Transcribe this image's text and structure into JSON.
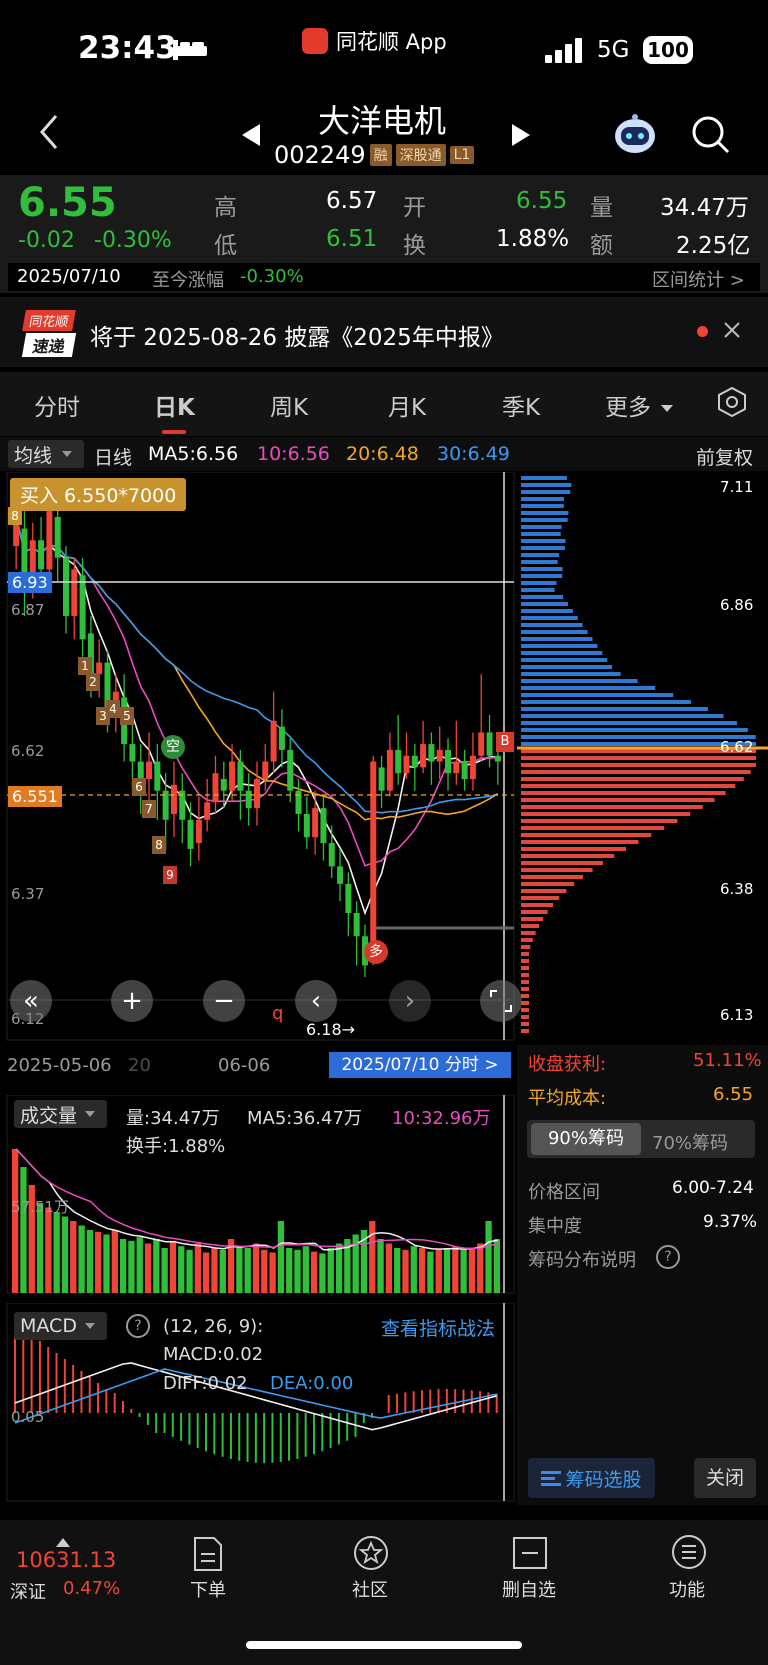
{
  "status": {
    "time": "23:43",
    "app": "同花顺 App",
    "net": "5G",
    "battery": "100"
  },
  "header": {
    "name": "大洋电机",
    "code": "002249",
    "tags": [
      "融",
      "深股通",
      "L1"
    ]
  },
  "quote": {
    "price": "6.55",
    "change": "-0.02",
    "pct": "-0.30%",
    "high_label": "高",
    "high": "6.57",
    "low_label": "低",
    "low": "6.51",
    "open_label": "开",
    "open": "6.55",
    "turn_label": "换",
    "turn": "1.88%",
    "vol_label": "量",
    "vol": "34.47万",
    "amt_label": "额",
    "amt": "2.25亿",
    "date": "2025/07/10",
    "since_label": "至今涨幅",
    "since": "-0.30%",
    "stat": "区间统计 >"
  },
  "notice": {
    "logo_top": "同花顺",
    "logo_bottom": "速递",
    "text": "将于 2025-08-26 披露《2025年中报》"
  },
  "tabs": [
    "分时",
    "日K",
    "周K",
    "月K",
    "季K",
    "更多"
  ],
  "ma_bar": {
    "select": "均线",
    "period": "日线",
    "ma5": "MA5:6.56",
    "ma10": "10:6.56",
    "ma20": "20:6.48",
    "ma30": "30:6.49",
    "adj": "前复权"
  },
  "chart": {
    "buy_label": "买入 6.550*7000",
    "price_marks": {
      "p693": "6.93",
      "p687": "6.87",
      "p662": "6.62",
      "p6551": "6.551",
      "p637": "6.37",
      "p612": "6.12",
      "low_label": "6.18→",
      "q": "q"
    },
    "right_ticks": [
      "7.11",
      "6.86",
      "6.62",
      "6.38",
      "6.13"
    ],
    "dates": [
      "2025-05-06",
      "20",
      "06-06"
    ],
    "intraday_link": "2025/07/10 分时 >",
    "badges": {
      "kong": "空",
      "duo": "多",
      "b": "B"
    },
    "td_numbers": [
      "8",
      "1",
      "2",
      "3",
      "4",
      "5",
      "6",
      "7",
      "8",
      "9"
    ]
  },
  "chart_data": {
    "type": "candlestick",
    "note_series": [
      "MA5",
      "MA10",
      "MA20",
      "MA30"
    ],
    "last_close": 6.55,
    "ma": {
      "MA5": 6.56,
      "MA10": 6.56,
      "MA20": 6.48,
      "MA30": 6.49
    }
  },
  "chip": {
    "profit_label": "收盘获利:",
    "profit": "51.11%",
    "cost_label": "平均成本:",
    "cost": "6.55",
    "tab_active": "90%筹码",
    "tab_other": "70%筹码",
    "range_label": "价格区间",
    "range": "6.00-7.24",
    "conc_label": "集中度",
    "conc": "9.37%",
    "explain": "筹码分布说明",
    "select_btn": "筹码选股",
    "close_btn": "关闭"
  },
  "volume": {
    "select": "成交量",
    "vol": "量:34.47万",
    "ma5": "MA5:36.47万",
    "ma10": "10:32.96万",
    "turn": "换手:1.88%",
    "level": "57.51万"
  },
  "macd": {
    "select": "MACD",
    "params": "(12, 26, 9):",
    "macd": "MACD:0.02",
    "diff": "DIFF:0.02",
    "dea": "DEA:0.00",
    "link": "查看指标战法",
    "level": "0.05"
  },
  "bottom": {
    "index_val": "10631.13",
    "index_name": "深证",
    "index_pct": "0.47%",
    "nav": [
      "下单",
      "社区",
      "删自选",
      "功能"
    ]
  }
}
